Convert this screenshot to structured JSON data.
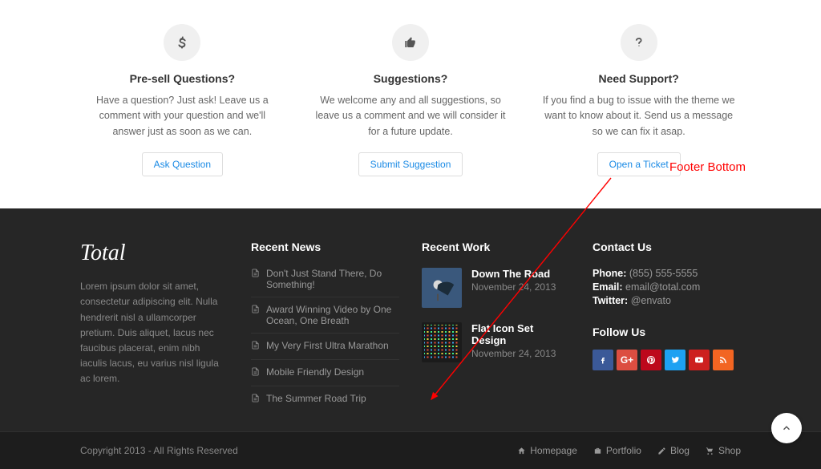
{
  "annotation": {
    "label": "Footer Bottom"
  },
  "features": [
    {
      "icon": "dollar",
      "title": "Pre-sell Questions?",
      "desc": "Have a question? Just ask! Leave us a comment with your question and we'll answer just as soon as we can.",
      "button": "Ask Question"
    },
    {
      "icon": "thumbs-up",
      "title": "Suggestions?",
      "desc": "We welcome any and all suggestions, so leave us a comment and we will consider it for a future update.",
      "button": "Submit Suggestion"
    },
    {
      "icon": "question",
      "title": "Need Support?",
      "desc": "If you find a bug to issue with the theme we want to know about it. Send us a message so we can fix it asap.",
      "button": "Open a Ticket"
    }
  ],
  "footer": {
    "logo": "Total",
    "about_text": "Lorem ipsum dolor sit amet, consectetur adipiscing elit. Nulla hendrerit nisl a ullamcorper pretium. Duis aliquet, lacus nec faucibus placerat, enim nibh iaculis lacus, eu varius nisl ligula ac lorem.",
    "news_heading": "Recent News",
    "news": [
      "Don't Just Stand There, Do Something!",
      "Award Winning Video by One Ocean, One Breath",
      "My Very First Ultra Marathon",
      "Mobile Friendly Design",
      "The Summer Road Trip"
    ],
    "work_heading": "Recent Work",
    "work": [
      {
        "title": "Down The Road",
        "date": "November 24, 2013"
      },
      {
        "title": "Flat Icon Set Design",
        "date": "November 24, 2013"
      }
    ],
    "contact_heading": "Contact Us",
    "contact": {
      "phone_label": "Phone:",
      "phone": "(855) 555-5555",
      "email_label": "Email:",
      "email": "email@total.com",
      "twitter_label": "Twitter:",
      "twitter": "@envato"
    },
    "follow_heading": "Follow Us"
  },
  "footer_bottom": {
    "copyright": "Copyright 2013 - All Rights Reserved",
    "nav": [
      {
        "icon": "home",
        "label": "Homepage"
      },
      {
        "icon": "briefcase",
        "label": "Portfolio"
      },
      {
        "icon": "pencil",
        "label": "Blog"
      },
      {
        "icon": "cart",
        "label": "Shop"
      }
    ]
  }
}
